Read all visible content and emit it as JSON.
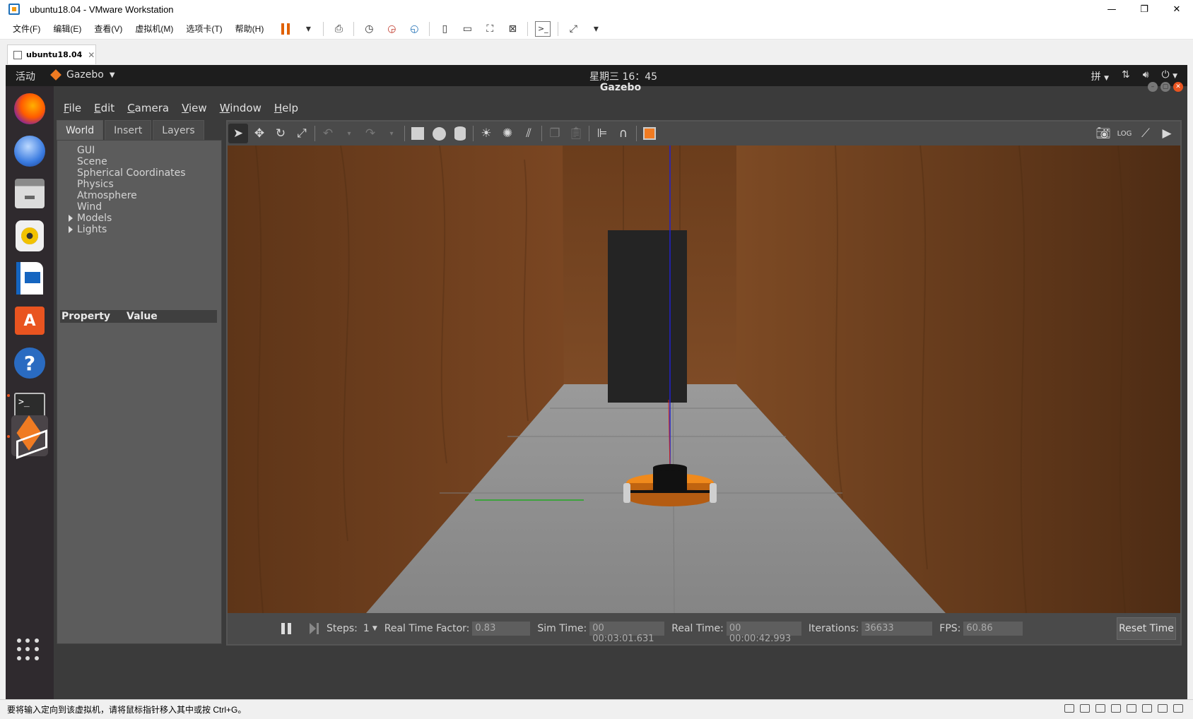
{
  "vmware": {
    "title": "ubuntu18.04 - VMware Workstation",
    "window_controls": [
      "—",
      "❐",
      "✕"
    ],
    "menus": [
      "文件(F)",
      "编辑(E)",
      "查看(V)",
      "虚拟机(M)",
      "选项卡(T)",
      "帮助(H)"
    ],
    "tab_label": "ubuntu18.04",
    "tab_close": "✕",
    "status_text": "要将输入定向到该虚拟机，请将鼠标指针移入其中或按 Ctrl+G。"
  },
  "ubuntu": {
    "activities": "活动",
    "app_name": "Gazebo",
    "clock": "星期三 16：45",
    "input_method": "拼",
    "tray_icons": [
      "network-icon",
      "volume-icon",
      "power-icon"
    ]
  },
  "dock": {
    "items": [
      "firefox-icon",
      "thunderbird-icon",
      "files-icon",
      "rhythmbox-icon",
      "libreoffice-writer-icon",
      "ubuntu-software-icon",
      "help-icon",
      "terminal-icon",
      "gazebo-icon"
    ],
    "terminal_glyph": ">_"
  },
  "gazebo": {
    "window_title": "Gazebo",
    "menus": [
      {
        "key": "F",
        "rest": "ile"
      },
      {
        "key": "E",
        "rest": "dit"
      },
      {
        "key": "C",
        "rest": "amera"
      },
      {
        "key": "V",
        "rest": "iew"
      },
      {
        "key": "W",
        "rest": "indow"
      },
      {
        "key": "H",
        "rest": "elp"
      }
    ],
    "panel_tabs": [
      "World",
      "Insert",
      "Layers"
    ],
    "tree_items": [
      "GUI",
      "Scene",
      "Spherical Coordinates",
      "Physics",
      "Atmosphere",
      "Wind",
      "Models",
      "Lights"
    ],
    "property_header": {
      "property": "Property",
      "value": "Value"
    },
    "toolbar_icons": [
      "select-arrow-icon",
      "translate-icon",
      "rotate-icon",
      "scale-icon",
      "undo-icon",
      "redo-icon",
      "box-icon",
      "sphere-icon",
      "cylinder-icon",
      "point-light-icon",
      "spot-light-icon",
      "directional-light-icon",
      "copy-icon",
      "paste-icon",
      "align-icon",
      "snap-icon",
      "view-angle-icon",
      "screenshot-icon",
      "log-icon",
      "plot-icon",
      "video-record-icon"
    ],
    "bottom_bar": {
      "steps_label": "Steps:",
      "steps_value": "1",
      "rtf_label": "Real Time Factor:",
      "rtf_value": "0.83",
      "sim_time_label": "Sim Time:",
      "sim_time_value": "00 00:03:01.631",
      "real_time_label": "Real Time:",
      "real_time_value": "00 00:00:42.993",
      "iterations_label": "Iterations:",
      "iterations_value": "36633",
      "fps_label": "FPS:",
      "fps_value": "60.86",
      "reset_label": "Reset Time"
    }
  },
  "colors": {
    "ubuntu_orange": "#e95420",
    "gazebo_orange": "#f07b22",
    "wood": "#7a4a26",
    "floor": "#8a8a8a"
  }
}
